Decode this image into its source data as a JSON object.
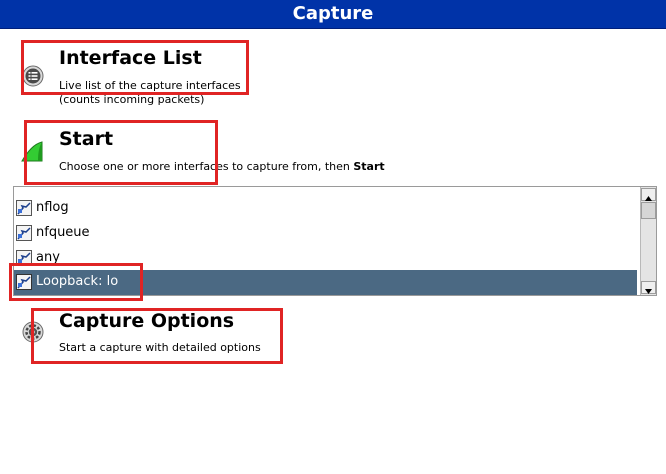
{
  "window": {
    "title": "Capture"
  },
  "interface_list": {
    "heading": "Interface List",
    "description_line1": "Live list of the capture interfaces",
    "description_line2": "(counts incoming packets)",
    "icon": "list-icon"
  },
  "start": {
    "heading": "Start",
    "description_prefix": "Choose one or more interfaces to capture from, then ",
    "description_bold": "Start",
    "icon": "shark-fin-icon"
  },
  "interfaces": {
    "items": [
      {
        "label": "nflog",
        "selected": false,
        "icon": "network-interface-icon"
      },
      {
        "label": "nfqueue",
        "selected": false,
        "icon": "network-interface-icon"
      },
      {
        "label": "any",
        "selected": false,
        "icon": "network-interface-icon"
      },
      {
        "label": "Loopback: lo",
        "selected": true,
        "icon": "network-interface-icon"
      }
    ],
    "selected_color": "#4b6983"
  },
  "capture_options": {
    "heading": "Capture Options",
    "description": "Start a capture with detailed options",
    "icon": "gear-icon"
  },
  "colors": {
    "title_bar": "#0033a8",
    "highlight_box": "#e02424",
    "selection": "#4b6983"
  }
}
